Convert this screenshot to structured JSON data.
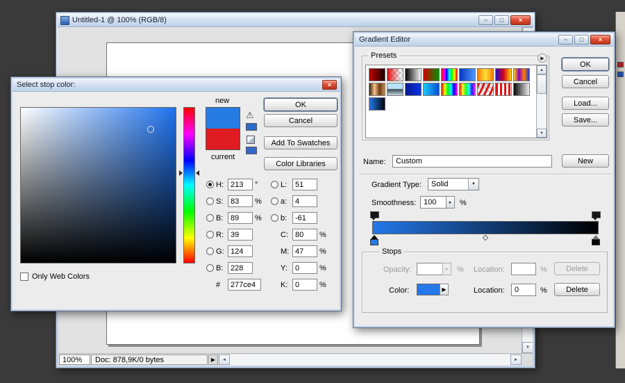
{
  "icons": {
    "minimize": "−",
    "maximize": "□",
    "close": "×",
    "warning": "⚠",
    "flyout": "▶",
    "up": "▲",
    "down": "▼",
    "left": "◄",
    "right": "►",
    "combo": "▼",
    "spin": "▸",
    "stop_menu": "▶",
    "status_menu": "▶"
  },
  "window": {
    "title": "Untitled-1 @ 100% (RGB/8)",
    "zoom": "100%",
    "doc_info": "Doc: 878,9K/0 bytes"
  },
  "color_picker": {
    "title": "Select stop color:",
    "new_label": "new",
    "current_label": "current",
    "ok": "OK",
    "cancel": "Cancel",
    "add_to_swatches": "Add To Swatches",
    "color_libraries": "Color Libraries",
    "only_web_colors": "Only Web Colors",
    "hex_label": "#",
    "hex_value": "277ce4",
    "new_color": "#277ce4",
    "current_color": "#df1c22",
    "gamut_chip_color": "#2a6cc8",
    "web_chip_color": "#3366cc",
    "field_bg": "linear-gradient(to bottom, rgba(0,0,0,0) 0%, #000 100%), linear-gradient(to right, #ffffff, #1e72ee)",
    "hue_bg": "linear-gradient(to bottom, #f00 0%, #f0f 17%, #00f 34%, #0ff 50%, #0f0 67%, #ff0 84%, #f00 100%)",
    "rows_left": [
      {
        "label": "H:",
        "value": "213",
        "unit": "°"
      },
      {
        "label": "S:",
        "value": "83",
        "unit": "%"
      },
      {
        "label": "B:",
        "value": "89",
        "unit": "%"
      },
      {
        "label": "R:",
        "value": "39",
        "unit": ""
      },
      {
        "label": "G:",
        "value": "124",
        "unit": ""
      },
      {
        "label": "B:",
        "value": "228",
        "unit": ""
      }
    ],
    "rows_right": [
      {
        "label": "L:",
        "value": "51",
        "unit": ""
      },
      {
        "label": "a:",
        "value": "4",
        "unit": ""
      },
      {
        "label": "b:",
        "value": "-61",
        "unit": ""
      },
      {
        "label": "C:",
        "value": "80",
        "unit": "%"
      },
      {
        "label": "M:",
        "value": "47",
        "unit": "%"
      },
      {
        "label": "Y:",
        "value": "0",
        "unit": "%"
      },
      {
        "label": "K:",
        "value": "0",
        "unit": "%"
      }
    ]
  },
  "gradient_editor": {
    "title": "Gradient Editor",
    "presets_label": "Presets",
    "ok": "OK",
    "cancel": "Cancel",
    "load": "Load...",
    "save": "Save...",
    "name_label": "Name:",
    "name_value": "Custom",
    "new": "New",
    "type_label": "Gradient Type:",
    "type_value": "Solid",
    "smoothness_label": "Smoothness:",
    "smoothness_value": "100",
    "percent": "%",
    "gradient_bar_bg": "linear-gradient(to right, #2478ea, #000000)",
    "stop_color_left": "#2478ea",
    "stop_color_right": "#050505",
    "stops_label": "Stops",
    "opacity_label": "Opacity:",
    "location_label": "Location:",
    "delete": "Delete",
    "color_label": "Color:",
    "color_location_value": "0",
    "presets": [
      "linear-gradient(to right,#c00303,#1a0000)",
      "linear-gradient(to right,#e01010,rgba(224,16,16,0) 85%),linear-gradient(45deg,#c9c9c9 25%,transparent 25%,transparent 75%,#c9c9c9 75%) 0 0/8px 8px,linear-gradient(45deg,#c9c9c9 25%,#fff 25%,#fff 75%,#c9c9c9 75%) 4px 4px/8px 8px",
      "linear-gradient(to right,#050505,#f5f5f5)",
      "linear-gradient(to right,#d00000,#009000)",
      "linear-gradient(to right,#f00 0%,#f0f 16%,#00f 33%,#0ff 50%,#0f0 66%,#ff0 83%,#f00 100%)",
      "linear-gradient(to right,#0536c6,#4f96f7)",
      "linear-gradient(to right,#ff7c00,#ffe13c,#ff7c00)",
      "linear-gradient(to right,#2a0bc4,#d5021c,#ffd400)",
      "linear-gradient(to right,#ffd400,#8d00c4,#ff7c00,#1a39d8)",
      "linear-gradient(to right,#3a230f,#f7c28a,#6c3a16,#c98d4f)",
      "linear-gradient(to bottom,#b8e2f8 45%,#3c4a56 50%,#7d8d99 75%,#c8d8e2)",
      "linear-gradient(to right,#071b8c,#0a35e8)",
      "linear-gradient(to right,#19c8f5,#0a50d8)",
      "linear-gradient(to right,#f00,#ff0,#0f0,#0ff,#00f,#f0f)",
      "linear-gradient(to right,rgba(255,0,0,.85),rgba(255,255,0,.85),rgba(0,255,0,.85),rgba(0,255,255,.85),rgba(0,0,255,.85),rgba(255,0,255,.85)),linear-gradient(45deg,#c9c9c9 25%,transparent 25%,transparent 75%,#c9c9c9 75%) 0 0/8px 8px,linear-gradient(45deg,#c9c9c9 25%,#fff 25%,#fff 75%,#c9c9c9 75%) 4px 4px/8px 8px",
      "repeating-linear-gradient(115deg,#e21212 0px,#e21212 3px,rgba(255,255,255,0) 3px,rgba(255,255,255,0) 7px),linear-gradient(45deg,#c9c9c9 25%,transparent 25%,transparent 75%,#c9c9c9 75%) 0 0/8px 8px,linear-gradient(45deg,#c9c9c9 25%,#fff 25%,#fff 75%,#c9c9c9 75%) 4px 4px/8px 8px",
      "repeating-linear-gradient(90deg,#e21212 0px,#e21212 3px,#ffffff 3px,#ffffff 6px)",
      "linear-gradient(to right,#0a0a0a,#ececec)",
      "linear-gradient(to right,#2478ea,#02060d)"
    ]
  },
  "panel_strip": {
    "chips": [
      "#bb2222",
      "#2255bb"
    ]
  }
}
